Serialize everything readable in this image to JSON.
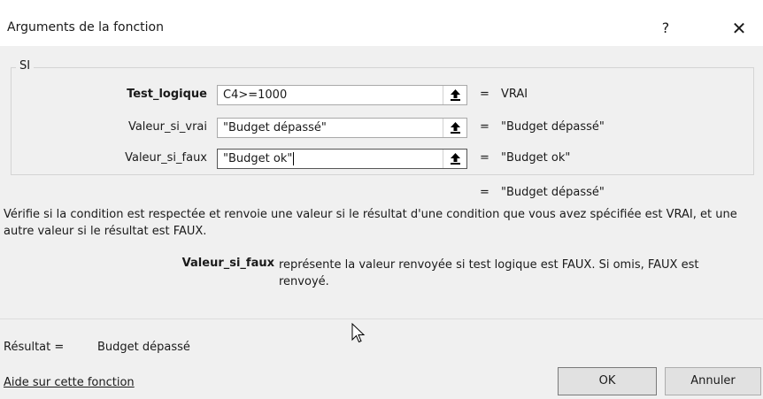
{
  "dialog": {
    "title": "Arguments de la fonction",
    "help_glyph": "?",
    "close_glyph": "✕"
  },
  "function": {
    "name": "SI",
    "args": [
      {
        "label": "Test_logique",
        "bold": true,
        "value": "C4>=1000",
        "result": "VRAI"
      },
      {
        "label": "Valeur_si_vrai",
        "bold": false,
        "value": "\"Budget dépassé\"",
        "result": "\"Budget dépassé\""
      },
      {
        "label": "Valeur_si_faux",
        "bold": false,
        "value": "\"Budget ok\"",
        "result": "\"Budget ok\""
      }
    ],
    "eq_sign": "=",
    "formula_result": "\"Budget dépassé\""
  },
  "description": {
    "text": "Vérifie si la condition est respectée et renvoie une valeur si le résultat d'une condition que vous avez spécifiée est VRAI, et une autre valeur si le résultat est FAUX.",
    "param_name": "Valeur_si_faux",
    "param_text": "représente la valeur renvoyée si test logique est FAUX. Si omis, FAUX est renvoyé."
  },
  "result": {
    "label": "Résultat =",
    "value": "Budget dépassé"
  },
  "footer": {
    "help_link": "Aide sur cette fonction",
    "ok_label": "OK",
    "cancel_label": "Annuler"
  }
}
